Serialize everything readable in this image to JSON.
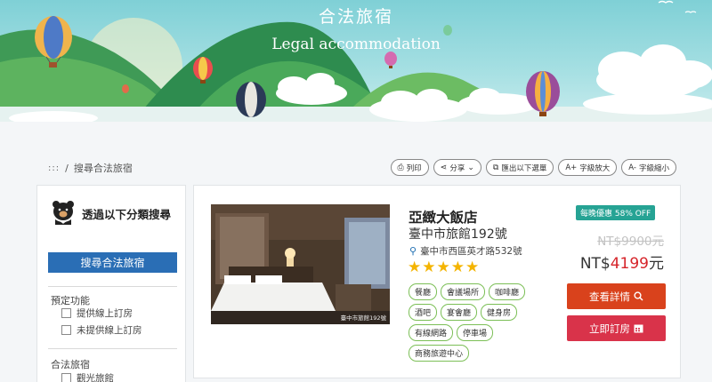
{
  "banner": {
    "title": "合法旅宿",
    "subtitle": "Legal accommodation"
  },
  "breadcrumb": {
    "home": ":::",
    "separator": "/",
    "current": "搜尋合法旅宿"
  },
  "toolbar": {
    "print": "列印",
    "share": "分享",
    "export": "匯出以下選單",
    "font_larger": "字級放大",
    "font_smaller": "字級縮小",
    "font_larger_prefix": "A+",
    "font_smaller_prefix": "A-"
  },
  "sidebar": {
    "heading": "透過以下分類搜尋",
    "search_button": "搜尋合法旅宿",
    "groups": [
      {
        "label": "預定功能",
        "options": [
          "提供線上訂房",
          "未提供線上訂房"
        ]
      },
      {
        "label": "合法旅宿",
        "options": [
          "觀光旅館"
        ]
      }
    ]
  },
  "listing": {
    "name": "亞緻大飯店",
    "registration": "臺中市旅館192號",
    "address": "臺中市西區英才路532號",
    "rating": 5,
    "image_caption": "臺中市旅館192號",
    "tags": [
      "餐廳",
      "會議場所",
      "咖啡廳",
      "酒吧",
      "宴會廳",
      "健身房",
      "有線網路",
      "停車場",
      "商務旅遊中心"
    ],
    "promo": "每晚優惠 58% OFF",
    "original_price": "NT$9900元",
    "price_prefix": "NT$",
    "price_amount": "4199",
    "price_suffix": "元",
    "detail_button": "查看詳情",
    "book_button": "立即訂房"
  },
  "colors": {
    "primary_button": "#2a6eb5",
    "detail_button": "#d9421c",
    "book_button": "#d9334a",
    "promo_badge": "#26a394",
    "tag_border": "#7cbf57",
    "price_highlight": "#d6242a",
    "star": "#f4b400"
  },
  "icons": {
    "print": "print-icon",
    "share": "share-icon",
    "export": "export-icon",
    "pin": "map-pin-icon",
    "search": "search-icon",
    "calendar": "calendar-icon"
  }
}
